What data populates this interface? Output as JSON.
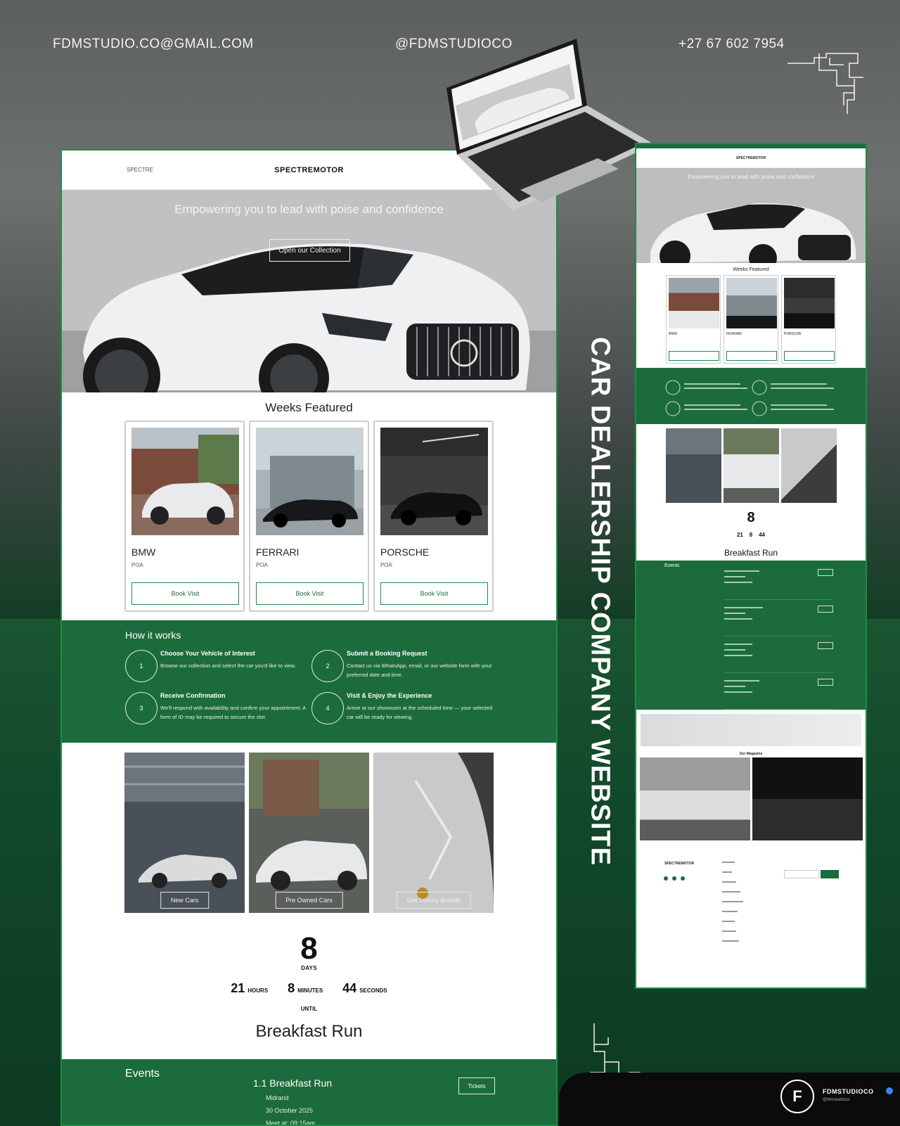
{
  "contact": {
    "email": "FDMSTUDIO.CO@GMAIL.COM",
    "social": "@FDMSTUDIOCO",
    "phone": "+27 67 602 7954"
  },
  "side_title": "CAR DEALERSHIP COMPANY WEBSITE",
  "desktop": {
    "logo_small": "SPECTRE",
    "brand": "SPECTREMOTOR",
    "hero": {
      "tagline": "Empowering you to lead with poise and confidence",
      "cta": "Open our Collection"
    },
    "featured_title": "Weeks Featured",
    "cards": [
      {
        "name": "BMW",
        "price": "POA",
        "button": "Book Visit"
      },
      {
        "name": "FERRARI",
        "price": "POA",
        "button": "Book Visit"
      },
      {
        "name": "PORSCHE",
        "price": "POA",
        "button": "Book Visit"
      }
    ],
    "how": {
      "title": "How it works",
      "steps": [
        {
          "num": "1",
          "title": "Choose Your Vehicle of Interest",
          "desc": "Browse our collection and select the car you'd like to view."
        },
        {
          "num": "2",
          "title": "Submit a Booking Request",
          "desc": "Contact us via WhatsApp, email, or our website form with your preferred date and time."
        },
        {
          "num": "3",
          "title": "Receive Confirmation",
          "desc": "We'll respond with availability and confirm your appointment. A form of ID may be required to secure the slot."
        },
        {
          "num": "4",
          "title": "Visit & Enjoy the Experience",
          "desc": "Arrive at our showroom at the scheduled time — your selected car will be ready for viewing."
        }
      ]
    },
    "tiles": [
      {
        "label": "New Cars"
      },
      {
        "label": "Pre Owned Cars"
      },
      {
        "label": "See Luxury Brands"
      }
    ],
    "countdown": {
      "days": "8",
      "days_label": "DAYS",
      "hours": "21",
      "hours_label": "HOURS",
      "minutes": "8",
      "minutes_label": "MINUTES",
      "seconds": "44",
      "seconds_label": "SECONDS",
      "until": "UNTIL",
      "event": "Breakfast Run"
    },
    "events": {
      "title": "Events",
      "name": "1.1 Breakfast Run",
      "location": "Midrand",
      "date": "30 October 2025",
      "meet": "Meet at: 09:15am",
      "tickets": "Tickets"
    }
  },
  "mobile": {
    "brand": "SPECTREMOTOR",
    "tagline": "Empowering you to lead with poise and confidence",
    "featured_title": "Weeks Featured",
    "cards": [
      "BMW",
      "FERRARI",
      "PORSCHE"
    ],
    "countdown": {
      "days": "8",
      "hours": "21",
      "minutes": "8",
      "seconds": "44"
    },
    "event": "Breakfast Run",
    "events_title": "Events",
    "magazine_title": "Our Magazine",
    "footer_brand": "SPECTREMOTOR"
  },
  "badge": {
    "logo": "F",
    "handle": "FDMSTUDIOCO",
    "sub": "@fdmstudioco"
  }
}
